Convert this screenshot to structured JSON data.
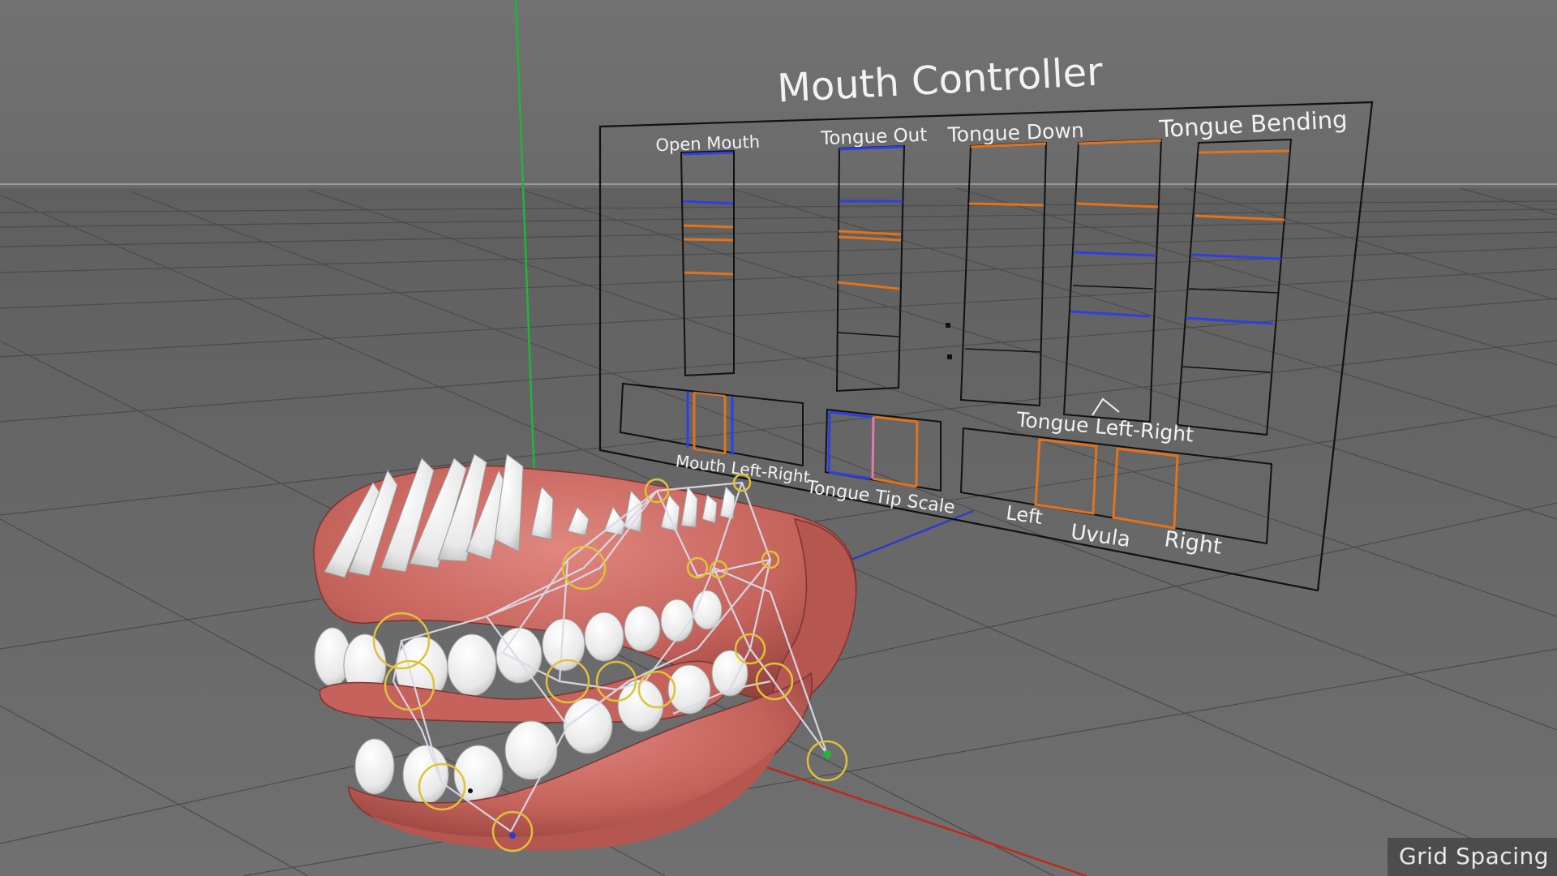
{
  "viewport": {
    "hud": {
      "grid_spacing_label": "Grid Spacing"
    }
  },
  "controller": {
    "title": "Mouth Controller",
    "labels": {
      "open_mouth": "Open Mouth",
      "tongue_out": "Tongue Out",
      "tongue_down": "Tongue Down",
      "tongue_bending": "Tongue Bending",
      "tongue_left_right": "Tongue Left-Right",
      "mouth_left_right": "Mouth Left-Right",
      "tongue_tip_scale": "Tongue Tip Scale",
      "left": "Left",
      "uvula": "Uvula",
      "right": "Right"
    }
  },
  "colors": {
    "background": "#6c6c6c",
    "grid_line": "#4a4a4a",
    "horizon": "#9a9a9a",
    "axis_y": "#23b33a",
    "axis_x": "#c0281e",
    "axis_z": "#2a3cc8",
    "slider_blue": "#2f3fe0",
    "slider_orange": "#e2721c",
    "gums": "#c7655e",
    "teeth": "#f2f2f2",
    "joint_ring": "#e0c23a",
    "bone": "#d8d8e6"
  },
  "icons": {
    "joint": "yellow-ring-joint-icon",
    "bone": "bone-pyramid-icon"
  }
}
